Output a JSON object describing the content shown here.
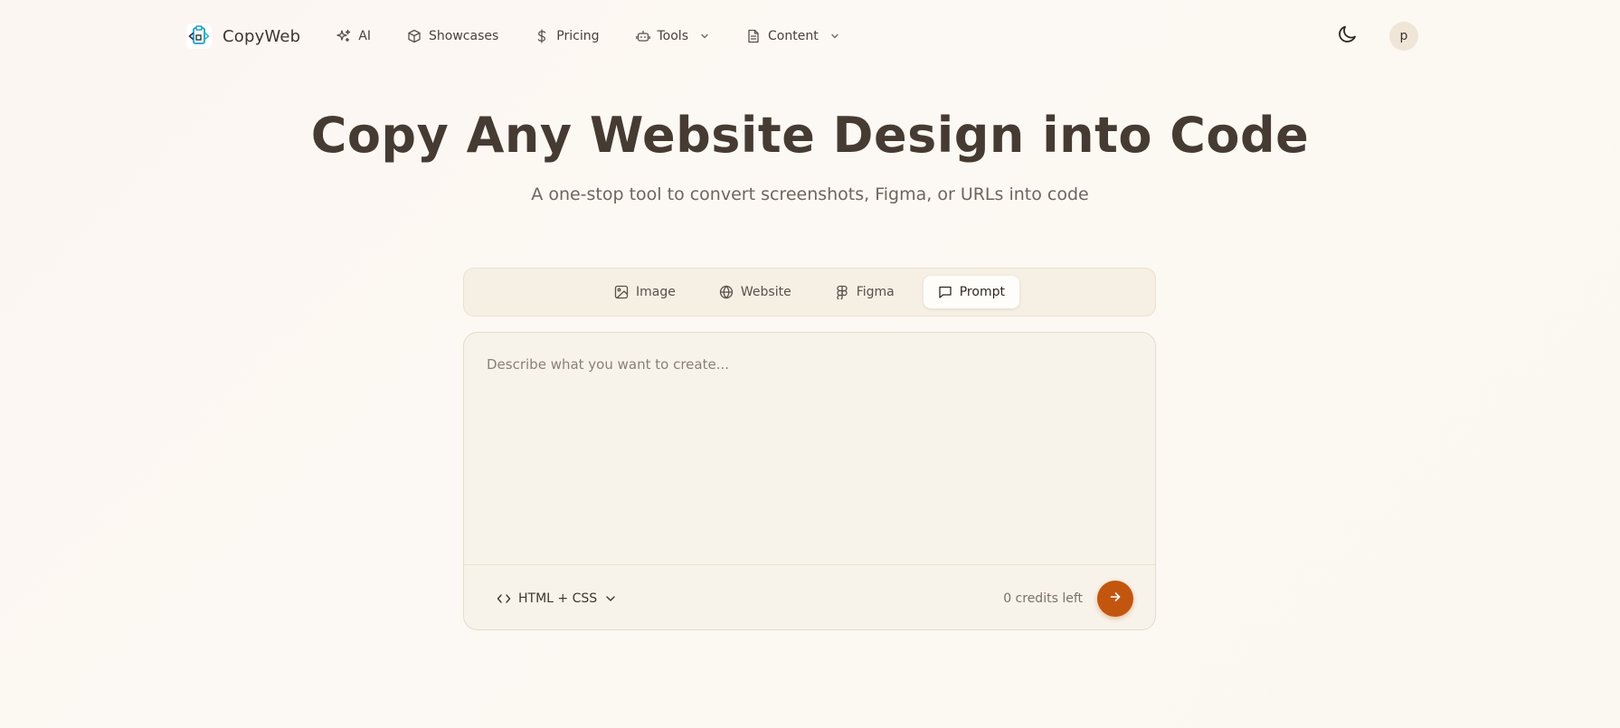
{
  "navbar": {
    "brand": {
      "name": "CopyWeb",
      "logo_icon": "clipboard-code-icon"
    },
    "links": [
      {
        "label": "AI",
        "icon": "sparkles-icon",
        "has_dropdown": false
      },
      {
        "label": "Showcases",
        "icon": "box-icon",
        "has_dropdown": false
      },
      {
        "label": "Pricing",
        "icon": "dollar-icon",
        "has_dropdown": false
      },
      {
        "label": "Tools",
        "icon": "robot-icon",
        "has_dropdown": true
      },
      {
        "label": "Content",
        "icon": "document-icon",
        "has_dropdown": true
      }
    ],
    "theme_toggle_icon": "moon-icon",
    "avatar_initial": "p"
  },
  "hero": {
    "title": "Copy Any Website Design into Code",
    "subtitle": "A one-stop tool to convert screenshots, Figma, or URLs into code"
  },
  "tabs": [
    {
      "label": "Image",
      "icon": "image-icon",
      "active": false
    },
    {
      "label": "Website",
      "icon": "globe-icon",
      "active": false
    },
    {
      "label": "Figma",
      "icon": "figma-icon",
      "active": false
    },
    {
      "label": "Prompt",
      "icon": "chat-icon",
      "active": true
    }
  ],
  "prompt": {
    "placeholder": "Describe what you want to create...",
    "value": "",
    "framework": {
      "selected": "HTML + CSS",
      "icon": "code-icon"
    },
    "credits": "0 credits left",
    "submit_icon": "arrow-right-icon"
  },
  "colors": {
    "accent": "#c2560f",
    "text_primary": "#463b33",
    "text_muted": "#6f655d",
    "background": "#fbf7f1"
  }
}
